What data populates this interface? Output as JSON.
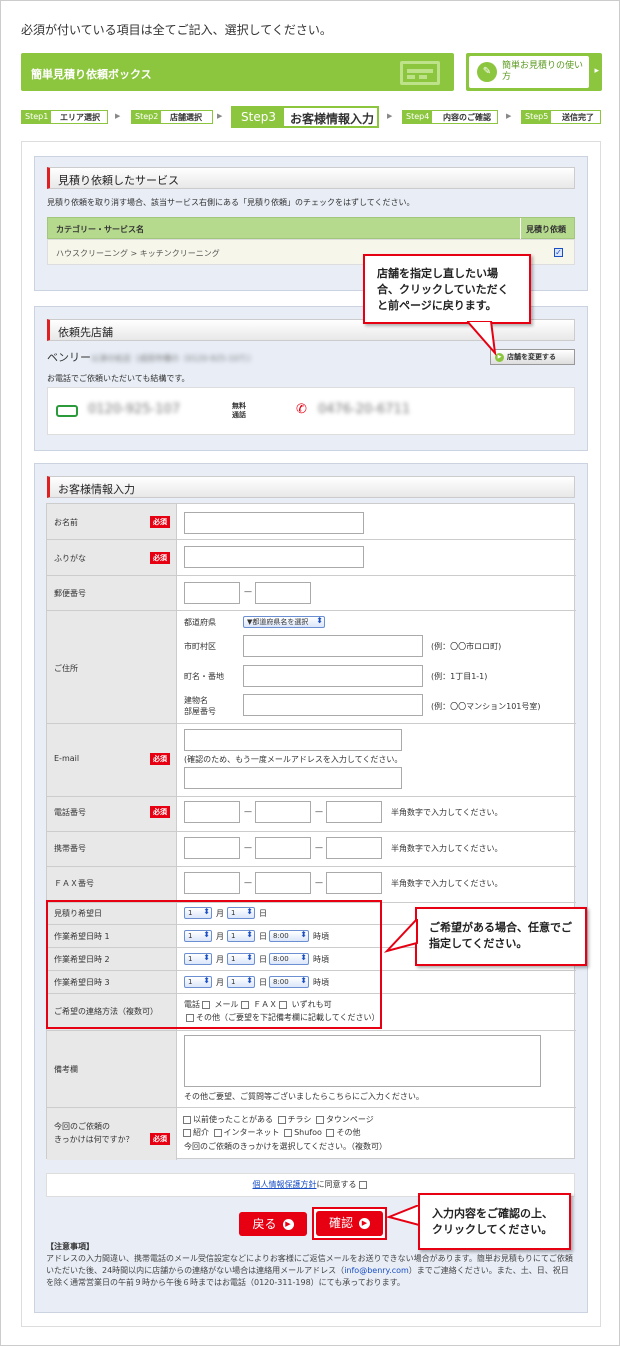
{
  "intro": "必須が付いている項目は全てご記入、選択してください。",
  "box_title": "簡単見積り依頼ボックス",
  "howto": "簡単お見積りの使い方",
  "steps": [
    {
      "num": "Step1",
      "label": "エリア選択"
    },
    {
      "num": "Step2",
      "label": "店舗選択"
    },
    {
      "num": "Step3",
      "label": "お客様情報入力"
    },
    {
      "num": "Step4",
      "label": "内容のご確認"
    },
    {
      "num": "Step5",
      "label": "送信完了"
    }
  ],
  "service": {
    "title": "見積り依頼したサービス",
    "note": "見積り依頼を取り消す場合、該当サービス右側にある「見積り依頼」のチェックをはずしてください。",
    "col1": "カテゴリー・サービス名",
    "col2": "見積り依頼",
    "row": "ハウスクリーニング > キッチンクリーニング"
  },
  "store": {
    "title": "依頼先店舗",
    "name": "ベンリー",
    "name_blur": "以津の松店（成田市幡の（0120-925-107））",
    "change_btn": "店舗を変更する",
    "note": "お電話でご依頼いただいても結構です。",
    "free_num": "0120-925-107",
    "free_label": "無料 通話",
    "tel": "0476-20-6711"
  },
  "callout1": "店舗を指定し直したい場合、クリックしていただくと前ページに戻ります。",
  "customer": {
    "title": "お客様情報入力",
    "required": "必須",
    "name": "お名前",
    "kana": "ふりがな",
    "zip": "郵便番号",
    "address": "ご住所",
    "pref": "都道府県",
    "pref_sel": "▼都道府県名を選択",
    "city": "市町村区",
    "city_ex": "(例：〇〇市ロロ町)",
    "town": "町名・番地",
    "town_ex": "(例：1丁目1-1)",
    "bld1": "建物名",
    "bld2": "部屋番号",
    "bld_ex": "(例：〇〇マンション101号室)",
    "email": "E-mail",
    "email_note": "(確認のため、もう一度メールアドレスを入力してください。",
    "phone": "電話番号",
    "mobile": "携帯番号",
    "fax": "ＦＡＸ番号",
    "num_note": "半角数字で入力してください。",
    "est_day": "見積り希望日",
    "work1": "作業希望日時 1",
    "work2": "作業希望日時 2",
    "work3": "作業希望日時 3",
    "month": "月",
    "day": "日",
    "time_suffix": "時頃",
    "one": "1",
    "time": "8:00",
    "contact": "ご希望の連絡方法（複数可）",
    "contact_opts": [
      "電話",
      "メール",
      "ＦＡＸ",
      "いずれも可"
    ],
    "contact_other": "その他（ご要望を下記備考欄に記載してください）",
    "remarks": "備考欄",
    "remarks_note": "その他ご要望、ご質問等ございましたらこちらにご入力ください。",
    "trigger1": "今回のご依頼の",
    "trigger2": "きっかけは何ですか？",
    "trig_row1": [
      "以前使ったことがある",
      "チラシ",
      "タウンページ"
    ],
    "trig_row2": [
      "紹介",
      "インターネット",
      "Shufoo",
      "その他"
    ],
    "trig_note": "今回のご依頼のきっかけを選択してください。（複数可）"
  },
  "callout2": "ご希望がある場合、任意でご指定してください。",
  "privacy_link": "個人情報保護方針",
  "privacy_rest": "に同意する",
  "back_btn": "戻る",
  "confirm_btn": "確認",
  "callout3": "入力内容をご確認の上、クリックしてください。",
  "notice_title": "【注意事項】",
  "notice_a": "アドレスの入力間違い、携帯電話のメール受信設定などによりお客様にご返信メールをお送りできない場合があります。簡単お見積もりにてご依頼いただいた後、24時間以内に店舗からの連絡がない場合は連絡用メールアドレス（",
  "notice_mail": "info@benry.com",
  "notice_b": "）までご連絡ください。また、土、日、祝日を除く通常営業日の午前９時から午後６時まではお電話（0120-311-198）にても承っております。",
  "colors": {
    "green": "#8cc63e",
    "red": "#e60012",
    "blue": "#1a4fc4"
  }
}
